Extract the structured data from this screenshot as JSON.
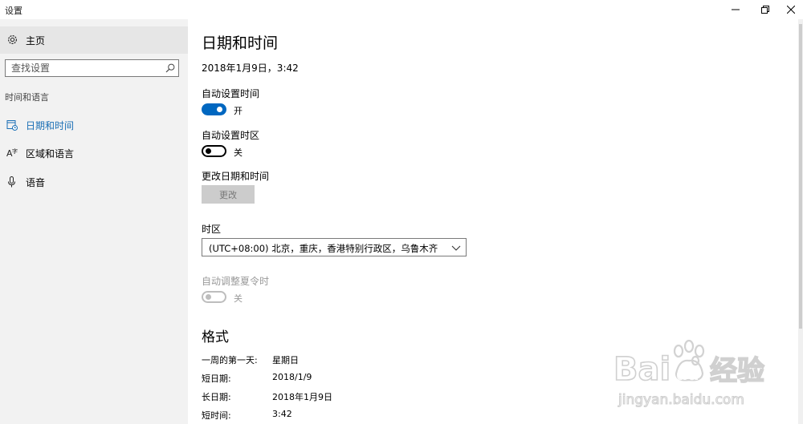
{
  "window": {
    "title": "设置"
  },
  "sidebar": {
    "home_label": "主页",
    "search_placeholder": "查找设置",
    "section_label": "时间和语言",
    "items": [
      {
        "label": "日期和时间",
        "icon": "calendar-clock-icon",
        "active": true
      },
      {
        "label": "区域和语言",
        "icon": "language-icon",
        "active": false
      },
      {
        "label": "语音",
        "icon": "microphone-icon",
        "active": false
      }
    ]
  },
  "main": {
    "title": "日期和时间",
    "current_datetime": "2018年1月9日，3:42",
    "auto_time": {
      "label": "自动设置时间",
      "state": "开",
      "on": true
    },
    "auto_timezone": {
      "label": "自动设置时区",
      "state": "关",
      "on": false
    },
    "change_datetime": {
      "label": "更改日期和时间",
      "button": "更改"
    },
    "timezone": {
      "label": "时区",
      "value": "(UTC+08:00) 北京，重庆，香港特别行政区，乌鲁木齐"
    },
    "dst": {
      "label": "自动调整夏令时",
      "state": "关",
      "on": false,
      "disabled": true
    },
    "format": {
      "title": "格式",
      "rows": [
        {
          "key": "一周的第一天:",
          "value": "星期日"
        },
        {
          "key": "短日期:",
          "value": "2018/1/9"
        },
        {
          "key": "长日期:",
          "value": "2018年1月9日"
        },
        {
          "key": "短时间:",
          "value": "3:42"
        }
      ]
    }
  },
  "watermark": {
    "brand": "Bai du 经验",
    "url": "jingyan.baidu.com"
  },
  "colors": {
    "accent": "#0067c0",
    "active_nav": "#1a6fb5",
    "sidebar_bg": "#f2f2f2"
  }
}
